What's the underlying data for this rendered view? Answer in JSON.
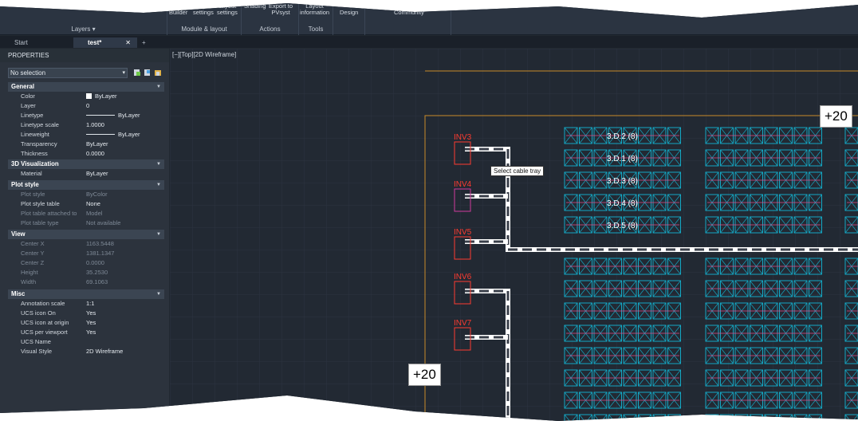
{
  "ribbon": {
    "buttons": [
      {
        "label": "Builder"
      },
      {
        "label": "settings"
      },
      {
        "label": "Layout\nsettings"
      },
      {
        "label": "Shading"
      },
      {
        "label": "Export to\nPVsyst"
      },
      {
        "label": "Layout\ninformation"
      },
      {
        "label": "Design"
      },
      {
        "label": "Community"
      }
    ],
    "panels": {
      "layers": "Layers ▾",
      "module_layout": "Module & layout",
      "actions": "Actions",
      "tools": "Tools"
    }
  },
  "tabs": {
    "start": "Start",
    "test": "test*",
    "close": "✕",
    "add": "+"
  },
  "properties": {
    "header": "PROPERTIES",
    "selection": "No selection",
    "general": {
      "title": "General",
      "rows": [
        {
          "name": "Color",
          "value": "ByLayer"
        },
        {
          "name": "Layer",
          "value": "0"
        },
        {
          "name": "Linetype",
          "value": "ByLayer"
        },
        {
          "name": "Linetype scale",
          "value": "1.0000"
        },
        {
          "name": "Lineweight",
          "value": "ByLayer"
        },
        {
          "name": "Transparency",
          "value": "ByLayer"
        },
        {
          "name": "Thickness",
          "value": "0.0000"
        }
      ]
    },
    "viz": {
      "title": "3D Visualization",
      "rows": [
        {
          "name": "Material",
          "value": "ByLayer"
        }
      ]
    },
    "plot": {
      "title": "Plot style",
      "rows": [
        {
          "name": "Plot style",
          "value": "ByColor"
        },
        {
          "name": "Plot style table",
          "value": "None"
        },
        {
          "name": "Plot table attached to",
          "value": "Model"
        },
        {
          "name": "Plot table type",
          "value": "Not available"
        }
      ]
    },
    "view": {
      "title": "View",
      "rows": [
        {
          "name": "Center X",
          "value": "1163.5448"
        },
        {
          "name": "Center Y",
          "value": "1381.1347"
        },
        {
          "name": "Center Z",
          "value": "0.0000"
        },
        {
          "name": "Height",
          "value": "35.2530"
        },
        {
          "name": "Width",
          "value": "69.1063"
        }
      ]
    },
    "misc": {
      "title": "Misc",
      "rows": [
        {
          "name": "Annotation scale",
          "value": "1:1"
        },
        {
          "name": "UCS icon On",
          "value": "Yes"
        },
        {
          "name": "UCS icon at origin",
          "value": "Yes"
        },
        {
          "name": "UCS per viewport",
          "value": "Yes"
        },
        {
          "name": "UCS Name",
          "value": ""
        },
        {
          "name": "Visual Style",
          "value": "2D Wireframe"
        }
      ]
    }
  },
  "canvas": {
    "view_label": "[−][Top][2D Wireframe]",
    "inverters": [
      "INV3",
      "INV4",
      "INV5",
      "INV6",
      "INV7"
    ],
    "blocks": [
      "3.D.2  (8)",
      "3.D.1  (8)",
      "3.D.3  (8)",
      "3.D.4  (8)",
      "3.D.5  (8)"
    ],
    "tooltip": "Select cable tray",
    "elevation_tags": [
      "+20",
      "+20"
    ]
  },
  "colors": {
    "accent_inverter": "#ff3b30",
    "module_cyan": "#14a8c4",
    "boundary": "#c88a2a"
  }
}
